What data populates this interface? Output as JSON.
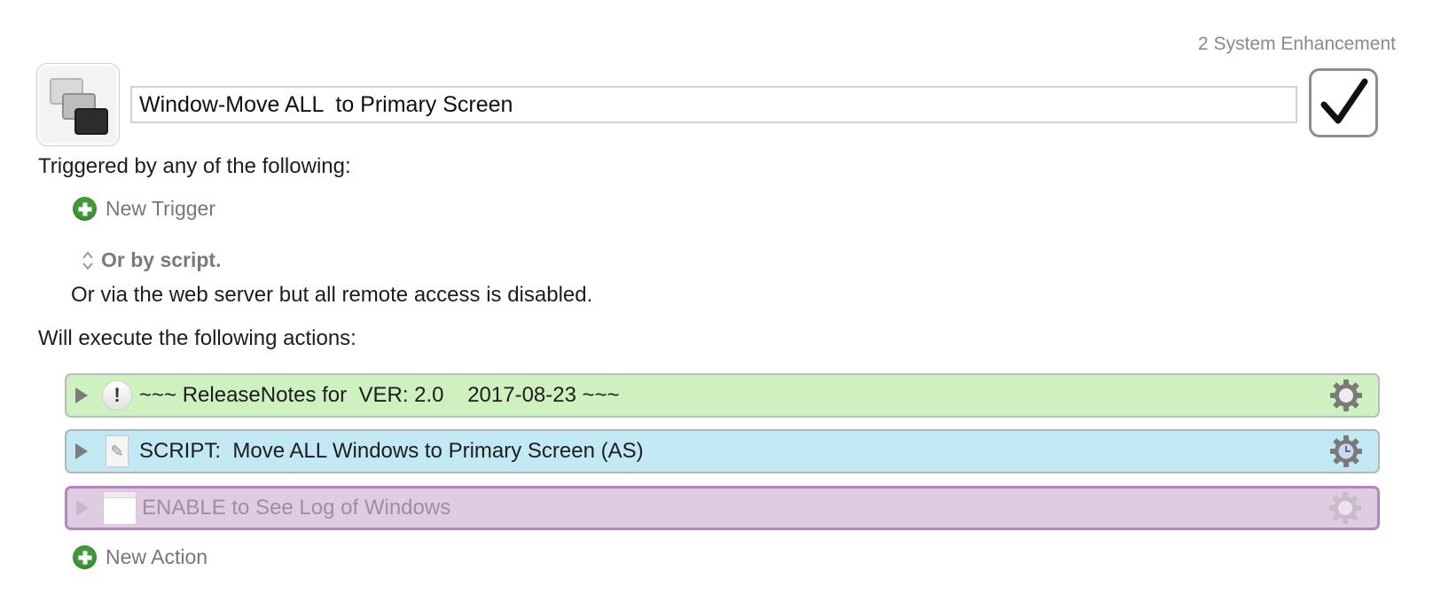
{
  "group_name": "2 System Enhancement",
  "macro": {
    "name": "Window-Move ALL  to Primary Screen",
    "enabled": true,
    "icon": "stacked-windows-icon"
  },
  "triggers": {
    "heading": "Triggered by any of the following:",
    "new_trigger_label": "New Trigger",
    "script_label": "Or by script.",
    "web_server_note": "Or via the web server but all remote access is disabled."
  },
  "actions": {
    "heading": "Will execute the following actions:",
    "items": [
      {
        "title": "~~~ ReleaseNotes for  VER: 2.0    2017-08-23 ~~~",
        "icon": "note-icon",
        "color": "#cdf1bf",
        "disabled": false
      },
      {
        "title": "SCRIPT:  Move ALL Windows to Primary Screen (AS)",
        "icon": "script-icon",
        "color": "#c1e8f3",
        "disabled": false
      },
      {
        "title": "ENABLE to See Log of Windows",
        "icon": "log-window-icon",
        "color": "#dfcce0",
        "disabled": true
      }
    ],
    "new_action_label": "New Action"
  },
  "colors": {
    "add_green": "#3f9a38",
    "disabled_border": "#b088bd"
  }
}
